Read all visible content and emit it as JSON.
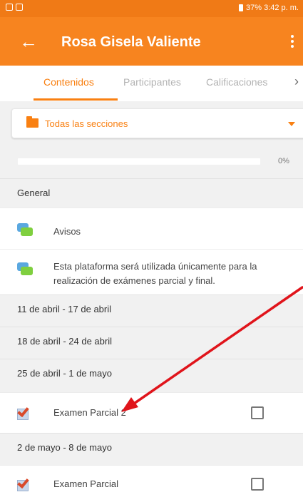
{
  "status_bar": {
    "right_text": "37% 3:42 p. m."
  },
  "app_bar": {
    "title": "Rosa Gisela Valiente",
    "back_icon": "arrow-left-icon",
    "menu_icon": "overflow-menu-icon"
  },
  "tabs": [
    {
      "label": "Contenidos",
      "active": true
    },
    {
      "label": "Participantes",
      "active": false
    },
    {
      "label": "Calificaciones",
      "active": false
    }
  ],
  "section_select": {
    "value": "Todas las secciones"
  },
  "progress": {
    "fraction": 0,
    "label": "0%"
  },
  "sections": {
    "general": "General",
    "s1": "11 de abril - 17 de abril",
    "s2": "18 de abril - 24 de abril",
    "s3": "25 de abril - 1 de mayo",
    "s4": "2 de mayo - 8 de mayo"
  },
  "items": {
    "avisos": "Avisos",
    "notice": "Esta plataforma será utilizada únicamente para la realización de exámenes parcial y final.",
    "exam2": "Examen Parcial 2",
    "exam1": "Examen Parcial"
  },
  "colors": {
    "accent": "#f98012",
    "app_bar": "#f7841f",
    "annotation_arrow": "#e0141b"
  }
}
